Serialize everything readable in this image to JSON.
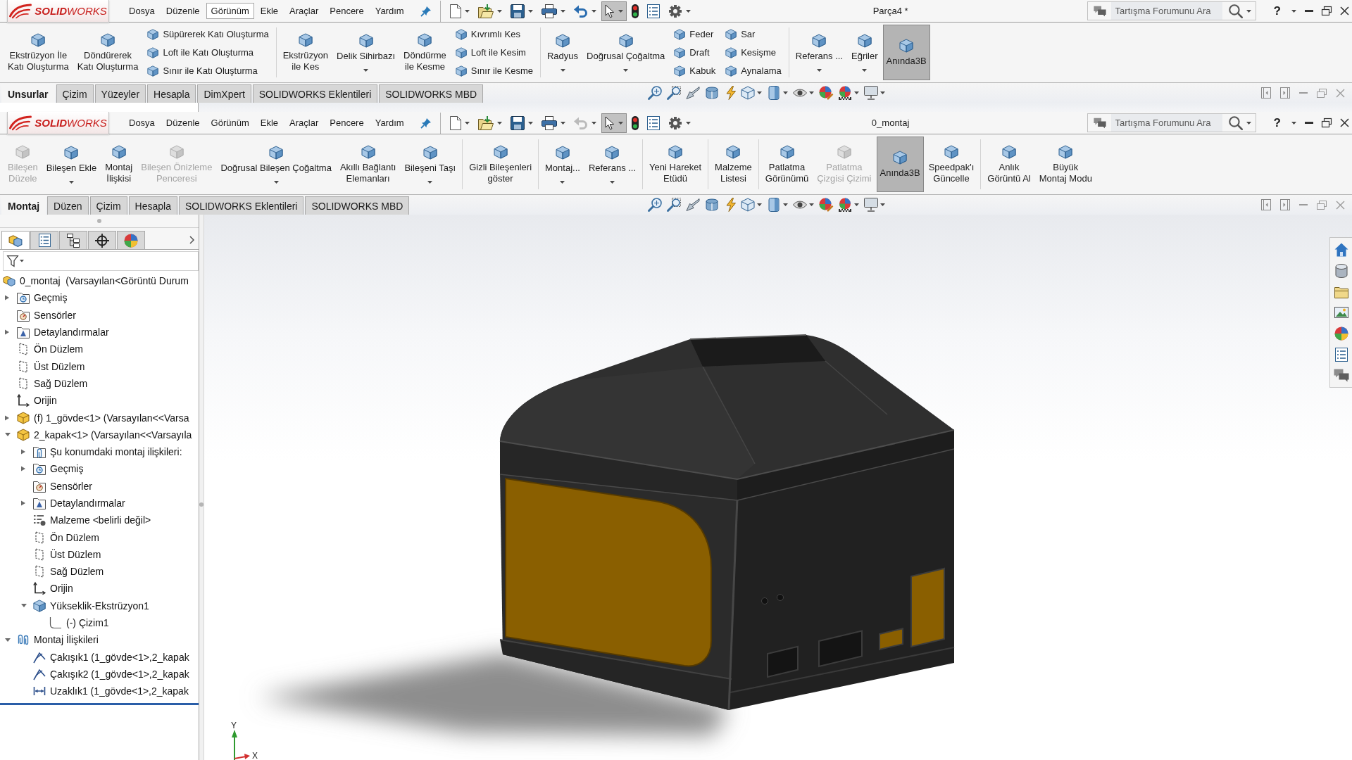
{
  "windows": [
    {
      "logo": "**SOLID**WORKS",
      "menu": [
        {
          "label": "Dosya",
          "selected": false
        },
        {
          "label": "Düzenle",
          "selected": false
        },
        {
          "label": "Görünüm",
          "selected": true
        },
        {
          "label": "Ekle",
          "selected": false
        },
        {
          "label": "Araçlar",
          "selected": false
        },
        {
          "label": "Pencere",
          "selected": false
        },
        {
          "label": "Yardım",
          "selected": false
        }
      ],
      "quick_access": [
        {
          "kind": "new",
          "dropdown": true,
          "selected": false,
          "disabled": false
        },
        {
          "kind": "open",
          "dropdown": true,
          "selected": false,
          "disabled": false
        },
        {
          "kind": "save",
          "dropdown": true,
          "selected": false,
          "disabled": false
        },
        {
          "kind": "print",
          "dropdown": true,
          "selected": false,
          "disabled": false
        },
        {
          "kind": "undo",
          "dropdown": true,
          "selected": false,
          "disabled": false
        },
        {
          "kind": "select",
          "dropdown": true,
          "selected": true,
          "disabled": false
        },
        {
          "kind": "rebuild",
          "dropdown": false,
          "selected": false,
          "disabled": false
        },
        {
          "kind": "properties",
          "dropdown": false,
          "selected": false,
          "disabled": false
        },
        {
          "kind": "options",
          "dropdown": true,
          "selected": false,
          "disabled": false
        }
      ],
      "document_title": "Parça4 *",
      "search": {
        "placeholder": "Tartışma Forumunu Ara"
      },
      "help": "?",
      "ribbon": [
        {
          "items": [
            {
              "kind": "large",
              "label": "Ekstrüzyon İle\nKatı Oluşturma",
              "dropdown": false,
              "disabled": false,
              "selected": false
            },
            {
              "kind": "large",
              "label": "Döndürerek\nKatı Oluşturma",
              "dropdown": false,
              "disabled": false,
              "selected": false
            },
            {
              "kind": "stack",
              "items": [
                {
                  "label": "Süpürerek Katı Oluşturma"
                },
                {
                  "label": "Loft ile Katı Oluşturma"
                },
                {
                  "label": "Sınır ile Katı Oluşturma"
                }
              ]
            }
          ]
        },
        {
          "items": [
            {
              "kind": "large",
              "label": "Ekstrüzyon\nile Kes",
              "dropdown": false,
              "disabled": false,
              "selected": false
            },
            {
              "kind": "large",
              "label": "Delik Sihirbazı",
              "dropdown": true,
              "disabled": false,
              "selected": false
            },
            {
              "kind": "large",
              "label": "Döndürme\nile Kesme",
              "dropdown": false,
              "disabled": false,
              "selected": false
            },
            {
              "kind": "stack",
              "items": [
                {
                  "label": "Kıvrımlı Kes"
                },
                {
                  "label": "Loft ile Kesim"
                },
                {
                  "label": "Sınır ile Kesme"
                }
              ]
            }
          ]
        },
        {
          "items": [
            {
              "kind": "large",
              "label": "Radyus",
              "dropdown": true,
              "disabled": false,
              "selected": false
            },
            {
              "kind": "large",
              "label": "Doğrusal Çoğaltma",
              "dropdown": true,
              "disabled": false,
              "selected": false
            },
            {
              "kind": "stack",
              "items": [
                {
                  "label": "Feder"
                },
                {
                  "label": "Draft"
                },
                {
                  "label": "Kabuk"
                }
              ]
            },
            {
              "kind": "stack",
              "items": [
                {
                  "label": "Sar"
                },
                {
                  "label": "Kesişme"
                },
                {
                  "label": "Aynalama"
                }
              ]
            }
          ]
        },
        {
          "items": [
            {
              "kind": "large",
              "label": "Referans ...",
              "dropdown": true,
              "disabled": false,
              "selected": false
            },
            {
              "kind": "large",
              "label": "Eğriler",
              "dropdown": true,
              "disabled": false,
              "selected": false
            },
            {
              "kind": "large",
              "label": "Anında3B",
              "dropdown": false,
              "disabled": false,
              "selected": true
            }
          ]
        }
      ],
      "tabs": [
        {
          "label": "Unsurlar",
          "selected": true
        },
        {
          "label": "Çizim",
          "selected": false
        },
        {
          "label": "Yüzeyler",
          "selected": false
        },
        {
          "label": "Hesapla",
          "selected": false
        },
        {
          "label": "DimXpert",
          "selected": false
        },
        {
          "label": "SOLIDWORKS Eklentileri",
          "selected": false
        },
        {
          "label": "SOLIDWORKS MBD",
          "selected": false
        }
      ]
    },
    {
      "logo": "**SOLID**WORKS",
      "menu": [
        {
          "label": "Dosya",
          "selected": false
        },
        {
          "label": "Düzenle",
          "selected": false
        },
        {
          "label": "Görünüm",
          "selected": false
        },
        {
          "label": "Ekle",
          "selected": false
        },
        {
          "label": "Araçlar",
          "selected": false
        },
        {
          "label": "Pencere",
          "selected": false
        },
        {
          "label": "Yardım",
          "selected": false
        }
      ],
      "quick_access": [
        {
          "kind": "new",
          "dropdown": true,
          "selected": false,
          "disabled": false
        },
        {
          "kind": "open",
          "dropdown": true,
          "selected": false,
          "disabled": false
        },
        {
          "kind": "save",
          "dropdown": true,
          "selected": false,
          "disabled": false
        },
        {
          "kind": "print",
          "dropdown": true,
          "selected": false,
          "disabled": false
        },
        {
          "kind": "undo",
          "dropdown": true,
          "selected": false,
          "disabled": true
        },
        {
          "kind": "select",
          "dropdown": true,
          "selected": true,
          "disabled": false
        },
        {
          "kind": "rebuild",
          "dropdown": false,
          "selected": false,
          "disabled": false
        },
        {
          "kind": "properties",
          "dropdown": false,
          "selected": false,
          "disabled": false
        },
        {
          "kind": "options",
          "dropdown": true,
          "selected": false,
          "disabled": false
        }
      ],
      "document_title": "0_montaj",
      "search": {
        "placeholder": "Tartışma Forumunu Ara"
      },
      "help": "?",
      "ribbon": [
        {
          "items": [
            {
              "kind": "large",
              "label": "Bileşen\nDüzele",
              "dropdown": false,
              "disabled": true,
              "selected": false
            },
            {
              "kind": "large",
              "label": "Bileşen Ekle",
              "dropdown": true,
              "disabled": false,
              "selected": false
            },
            {
              "kind": "large",
              "label": "Montaj\nİlişkisi",
              "dropdown": false,
              "disabled": false,
              "selected": false
            },
            {
              "kind": "large",
              "label": "Bileşen Önizleme\nPenceresi",
              "dropdown": false,
              "disabled": true,
              "selected": false
            },
            {
              "kind": "large",
              "label": "Doğrusal Bileşen Çoğaltma",
              "dropdown": true,
              "disabled": false,
              "selected": false
            },
            {
              "kind": "large",
              "label": "Akıllı Bağlantı\nElemanları",
              "dropdown": false,
              "disabled": false,
              "selected": false
            },
            {
              "kind": "large",
              "label": "Bileşeni Taşı",
              "dropdown": true,
              "disabled": false,
              "selected": false
            }
          ]
        },
        {
          "items": [
            {
              "kind": "large",
              "label": "Gizli Bileşenleri\ngöster",
              "dropdown": false,
              "disabled": false,
              "selected": false
            }
          ]
        },
        {
          "items": [
            {
              "kind": "large",
              "label": "Montaj...",
              "dropdown": true,
              "disabled": false,
              "selected": false
            },
            {
              "kind": "large",
              "label": "Referans ...",
              "dropdown": true,
              "disabled": false,
              "selected": false
            }
          ]
        },
        {
          "items": [
            {
              "kind": "large",
              "label": "Yeni Hareket\nEtüdü",
              "dropdown": false,
              "disabled": false,
              "selected": false
            }
          ]
        },
        {
          "items": [
            {
              "kind": "large",
              "label": "Malzeme\nListesi",
              "dropdown": false,
              "disabled": false,
              "selected": false
            }
          ]
        },
        {
          "items": [
            {
              "kind": "large",
              "label": "Patlatma\nGörünümü",
              "dropdown": false,
              "disabled": false,
              "selected": false
            },
            {
              "kind": "large",
              "label": "Patlatma\nÇizgisi Çizimi",
              "dropdown": false,
              "disabled": true,
              "selected": false
            },
            {
              "kind": "large",
              "label": "Anında3B",
              "dropdown": false,
              "disabled": false,
              "selected": true
            },
            {
              "kind": "large",
              "label": "Speedpak'ı\nGüncelle",
              "dropdown": false,
              "disabled": false,
              "selected": false
            }
          ]
        },
        {
          "items": [
            {
              "kind": "large",
              "label": "Anlık\nGörüntü Al",
              "dropdown": false,
              "disabled": false,
              "selected": false
            },
            {
              "kind": "large",
              "label": "Büyük\nMontaj Modu",
              "dropdown": false,
              "disabled": false,
              "selected": false
            }
          ]
        }
      ],
      "tabs": [
        {
          "label": "Montaj",
          "selected": true
        },
        {
          "label": "Düzen",
          "selected": false
        },
        {
          "label": "Çizim",
          "selected": false
        },
        {
          "label": "Hesapla",
          "selected": false
        },
        {
          "label": "SOLIDWORKS Eklentileri",
          "selected": false
        },
        {
          "label": "SOLIDWORKS MBD",
          "selected": false
        }
      ]
    }
  ],
  "feature_tree": {
    "panel_tabs": [
      {
        "kind": "features",
        "selected": true
      },
      {
        "kind": "properties",
        "selected": false
      },
      {
        "kind": "configurations",
        "selected": false
      },
      {
        "kind": "dimxpert",
        "selected": false
      },
      {
        "kind": "display",
        "selected": false
      }
    ],
    "nodes": [
      {
        "kind": "assembly",
        "label": "0_montaj  (Varsayılan<Görüntü Durum",
        "children": [
          {
            "kind": "history",
            "label": "Geçmiş",
            "expanded": false
          },
          {
            "kind": "sensors",
            "label": "Sensörler"
          },
          {
            "kind": "annotations",
            "label": "Detaylandırmalar",
            "expanded": false
          },
          {
            "kind": "plane",
            "label": "Ön Düzlem"
          },
          {
            "kind": "plane",
            "label": "Üst Düzlem"
          },
          {
            "kind": "plane",
            "label": "Sağ Düzlem"
          },
          {
            "kind": "origin",
            "label": "Orijin"
          },
          {
            "kind": "part",
            "label": "(f) 1_gövde<1> (Varsayılan<<Varsa",
            "expanded": false
          },
          {
            "kind": "part",
            "label": "2_kapak<1> (Varsayılan<<Varsayıla",
            "expanded": true,
            "children": [
              {
                "kind": "mate-group",
                "label": "Şu konumdaki montaj ilişkileri:",
                "expanded": false
              },
              {
                "kind": "history",
                "label": "Geçmiş",
                "expanded": false
              },
              {
                "kind": "sensors",
                "label": "Sensörler"
              },
              {
                "kind": "annotations",
                "label": "Detaylandırmalar",
                "expanded": false
              },
              {
                "kind": "material",
                "label": "Malzeme <belirli değil>"
              },
              {
                "kind": "plane",
                "label": "Ön Düzlem"
              },
              {
                "kind": "plane",
                "label": "Üst Düzlem"
              },
              {
                "kind": "plane",
                "label": "Sağ Düzlem"
              },
              {
                "kind": "origin",
                "label": "Orijin"
              },
              {
                "kind": "extrusion",
                "label": "Yükseklik-Ekstrüzyon1",
                "expanded": true,
                "children": [
                  {
                    "kind": "sketch",
                    "label": "(-) Çizim1"
                  }
                ]
              }
            ]
          },
          {
            "kind": "mates",
            "label": "Montaj İlişkileri",
            "expanded": true,
            "children": [
              {
                "kind": "coincident",
                "label": "Çakışık1 (1_gövde<1>,2_kapak"
              },
              {
                "kind": "coincident",
                "label": "Çakışık2 (1_gövde<1>,2_kapak"
              },
              {
                "kind": "distance",
                "label": "Uzaklık1 (1_gövde<1>,2_kapak"
              }
            ]
          }
        ]
      }
    ]
  },
  "triad": {
    "y_label": "Y",
    "x_label": "X"
  }
}
